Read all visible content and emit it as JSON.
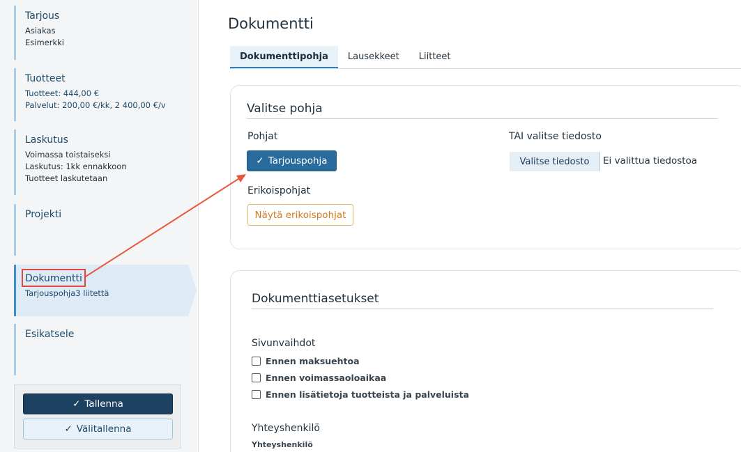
{
  "sidebar": {
    "steps": [
      {
        "title": "Tarjous",
        "lines": [
          "Asiakas",
          "Esimerkki"
        ]
      },
      {
        "title": "Tuotteet",
        "lines": [
          "Tuotteet: 444,00 €",
          "Palvelut: 200,00 €/kk, 2 400,00 €/v"
        ]
      },
      {
        "title": "Laskutus",
        "lines": [
          "Voimassa toistaiseksi",
          "Laskutus: 1kk ennakkoon",
          "Tuotteet laskutetaan"
        ]
      },
      {
        "title": "Projekti",
        "lines": []
      },
      {
        "title": "Dokumentti",
        "lines": [
          "Tarjouspohja3 liitettä"
        ]
      },
      {
        "title": "Esikatsele",
        "lines": []
      }
    ],
    "save_label": "Tallenna",
    "draft_label": "Välitallenna"
  },
  "main": {
    "title": "Dokumentti",
    "tabs": [
      {
        "label": "Dokumenttipohja"
      },
      {
        "label": "Lausekkeet"
      },
      {
        "label": "Liitteet"
      }
    ],
    "template_card": {
      "heading": "Valitse pohja",
      "templates_label": "Pohjat",
      "selected_template": "Tarjouspohja",
      "special_label": "Erikoispohjat",
      "show_special_button": "Näytä erikoispohjat",
      "file_label": "TAI valitse tiedosto",
      "file_button": "Valitse tiedosto",
      "file_status": "Ei valittua tiedostoa"
    },
    "settings_card": {
      "heading": "Dokumenttiasetukset",
      "page_breaks_label": "Sivunvaihdot",
      "checkboxes": [
        {
          "label": "Ennen maksuehtoa",
          "checked": false
        },
        {
          "label": "Ennen voimassaoloaikaa",
          "checked": false
        },
        {
          "label": "Ennen lisätietoja tuotteista ja palveluista",
          "checked": false
        }
      ],
      "contact_label": "Yhteyshenkilö",
      "contact_sublabel": "Yhteyshenkilö"
    }
  },
  "annotation": {
    "color": "#e2473d"
  }
}
